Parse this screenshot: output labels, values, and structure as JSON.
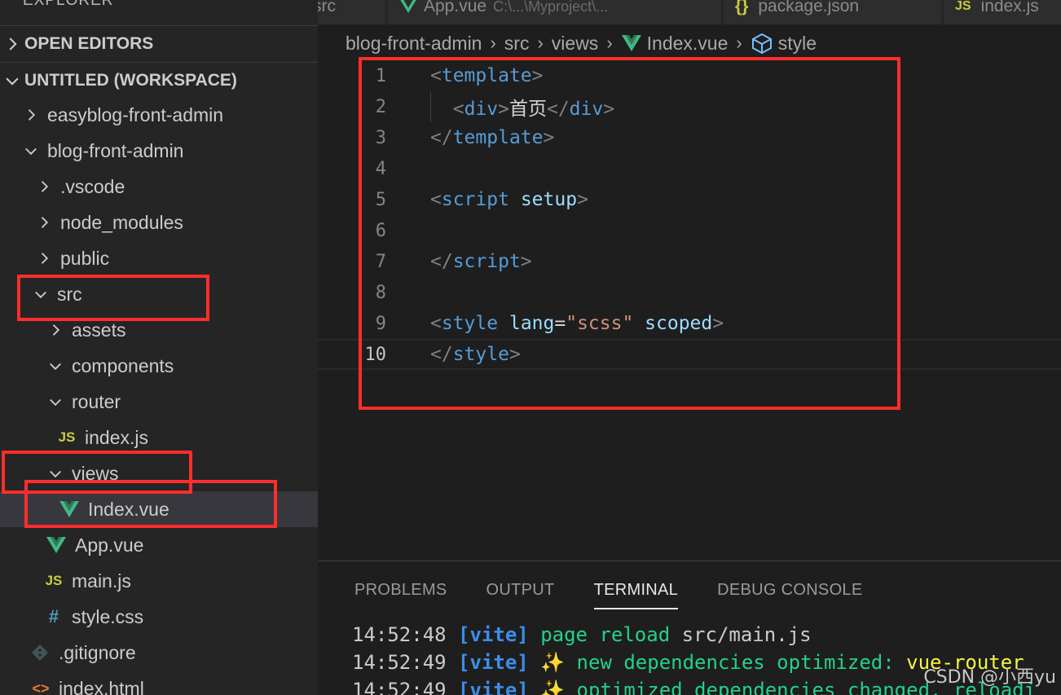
{
  "sidebar": {
    "header": "EXPLORER",
    "sections": {
      "open_editors": "OPEN EDITORS",
      "workspace": "UNTITLED (WORKSPACE)"
    },
    "tree": [
      {
        "label": "easyblog-front-admin",
        "type": "folder",
        "expanded": false
      },
      {
        "label": "blog-front-admin",
        "type": "folder",
        "expanded": true
      },
      {
        "label": ".vscode",
        "type": "folder",
        "expanded": false
      },
      {
        "label": "node_modules",
        "type": "folder",
        "expanded": false
      },
      {
        "label": "public",
        "type": "folder",
        "expanded": false
      },
      {
        "label": "src",
        "type": "folder",
        "expanded": true
      },
      {
        "label": "assets",
        "type": "folder",
        "expanded": false
      },
      {
        "label": "components",
        "type": "folder",
        "expanded": true
      },
      {
        "label": "router",
        "type": "folder",
        "expanded": true
      },
      {
        "label": "index.js",
        "type": "js",
        "icon": "JS"
      },
      {
        "label": "views",
        "type": "folder",
        "expanded": true
      },
      {
        "label": "Index.vue",
        "type": "vue",
        "selected": true
      },
      {
        "label": "App.vue",
        "type": "vue"
      },
      {
        "label": "main.js",
        "type": "js",
        "icon": "JS"
      },
      {
        "label": "style.css",
        "type": "css",
        "icon": "#"
      },
      {
        "label": ".gitignore",
        "type": "git"
      },
      {
        "label": "index.html",
        "type": "html",
        "icon": "<>"
      }
    ]
  },
  "tabs": [
    {
      "label": "src",
      "sub": ""
    },
    {
      "label": "App.vue",
      "sub": "C:\\...\\Myproject\\..."
    },
    {
      "label": "package.json",
      "sub": ""
    },
    {
      "label": "index.js",
      "sub": ""
    }
  ],
  "breadcrumb": {
    "parts": [
      "blog-front-admin",
      "src",
      "views",
      "Index.vue",
      "style"
    ]
  },
  "editor": {
    "line_numbers": [
      "1",
      "2",
      "3",
      "4",
      "5",
      "6",
      "7",
      "8",
      "9",
      "10"
    ],
    "current_line": 10,
    "code": {
      "l1_tag": "template",
      "l2_tag": "div",
      "l2_text": "首页",
      "l3_tag": "template",
      "l5_tag": "script",
      "l5_attr": "setup",
      "l7_tag": "script",
      "l9_tag": "style",
      "l9_attr_lang": "lang",
      "l9_val": "\"scss\"",
      "l9_attr_scoped": "scoped",
      "l10_tag": "style"
    }
  },
  "panel": {
    "tabs": [
      "PROBLEMS",
      "OUTPUT",
      "TERMINAL",
      "DEBUG CONSOLE"
    ],
    "active_tab": "TERMINAL",
    "terminal": [
      {
        "time": "14:52:48",
        "tag": "[vite]",
        "msg": "page reload",
        "extra": "src/main.js"
      },
      {
        "time": "14:52:49",
        "tag": "[vite]",
        "spark": "✨",
        "msg": "new dependencies optimized:",
        "extra": "vue-router"
      },
      {
        "time": "14:52:49",
        "tag": "[vite]",
        "spark": "✨",
        "msg": "optimized dependencies changed. reloadi",
        "extra": ""
      }
    ]
  },
  "watermark": "CSDN @小西yu",
  "colors": {
    "highlight": "#ff2d2d",
    "vue_green": "#41b883",
    "js_yellow": "#cbcb41"
  }
}
